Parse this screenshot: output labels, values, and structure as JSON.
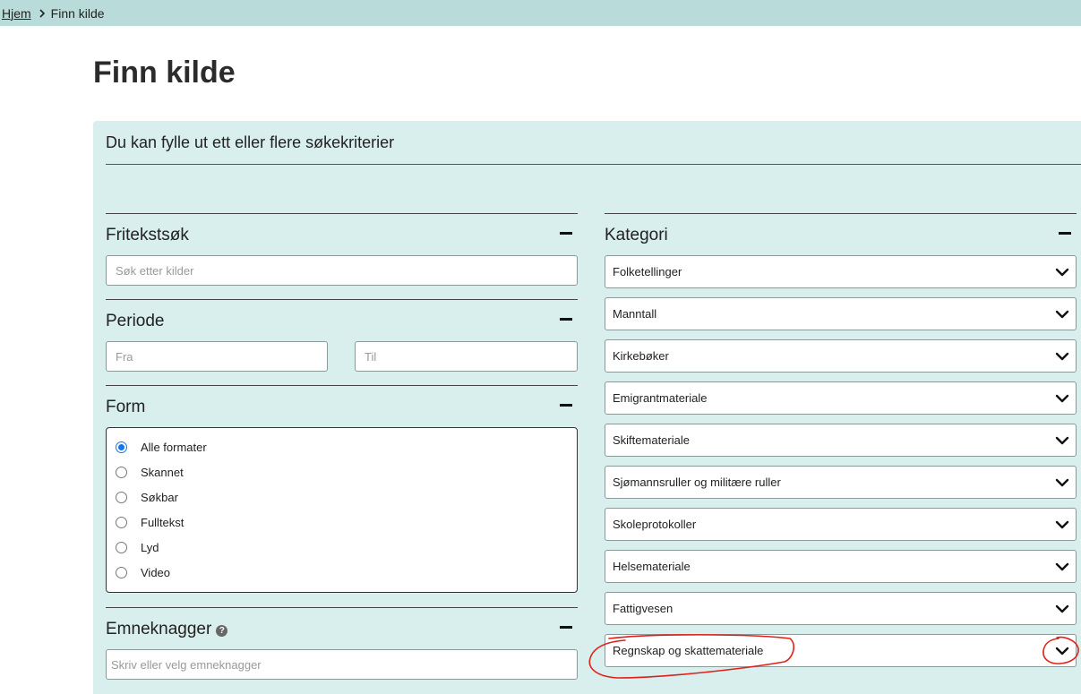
{
  "breadcrumb": {
    "home": "Hjem",
    "current": "Finn kilde"
  },
  "page": {
    "title": "Finn kilde",
    "intro": "Du kan fylle ut ett eller flere søkekriterier"
  },
  "filters": {
    "fritekst": {
      "heading": "Fritekstsøk",
      "placeholder": "Søk etter kilder"
    },
    "periode": {
      "heading": "Periode",
      "from_placeholder": "Fra",
      "to_placeholder": "Til"
    },
    "form": {
      "heading": "Form",
      "selected": "Alle formater",
      "options": [
        "Alle formater",
        "Skannet",
        "Søkbar",
        "Fulltekst",
        "Lyd",
        "Video"
      ]
    },
    "emneknagger": {
      "heading": "Emneknagger",
      "help_icon": "question-circle-icon",
      "placeholder": "Skriv eller velg emneknagger"
    }
  },
  "kategori": {
    "heading": "Kategori",
    "items": [
      "Folketellinger",
      "Manntall",
      "Kirkebøker",
      "Emigrantmateriale",
      "Skiftemateriale",
      "Sjømannsruller og militære ruller",
      "Skoleprotokoller",
      "Helsemateriale",
      "Fattigvesen",
      "Regnskap og skattemateriale"
    ]
  },
  "colors": {
    "breadcrumb_bg": "#b9dcda",
    "panel_bg": "#d8efed",
    "annotation": "#e0201b",
    "radio_accent": "#1a73e8"
  }
}
